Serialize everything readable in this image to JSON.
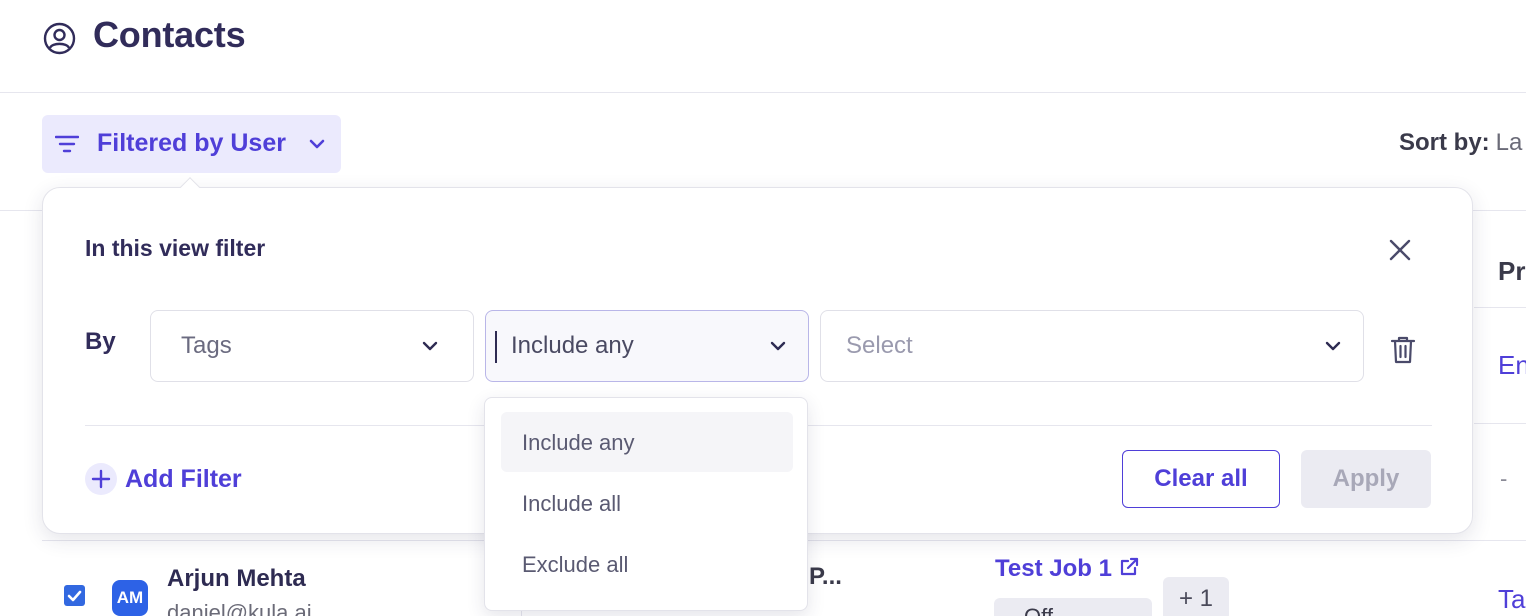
{
  "header": {
    "title": "Contacts",
    "icon": "user-circle-icon"
  },
  "toolbar": {
    "filter_button_label": "Filtered by User",
    "sort_label": "Sort by:",
    "sort_value": "La"
  },
  "filter_panel": {
    "title": "In this view filter",
    "by_label": "By",
    "field_select": {
      "value": "Tags"
    },
    "operator_select": {
      "value": "Include any"
    },
    "value_select": {
      "placeholder": "Select"
    },
    "add_filter_label": "Add Filter",
    "clear_all_label": "Clear all",
    "apply_label": "Apply"
  },
  "operator_menu": {
    "options": [
      "Include any",
      "Include all",
      "Exclude all"
    ],
    "active_index": 0
  },
  "background_table": {
    "col_header_peek": "Pr",
    "row1_peek_link": "En",
    "row2_peek_dash": "-",
    "row3": {
      "avatar_initials": "AM",
      "name": "Arjun Mehta",
      "email": "daniel@kula.ai",
      "col2_text": "P...",
      "job_link": "Test Job 1",
      "extra_count": "+ 1",
      "chip_text": "Off",
      "peek_link": "Ta"
    }
  },
  "colors": {
    "accent": "#4f3fd8",
    "accent_bg": "#ebeafd",
    "title_text": "#312c5a",
    "checkbox": "#3268e0"
  }
}
